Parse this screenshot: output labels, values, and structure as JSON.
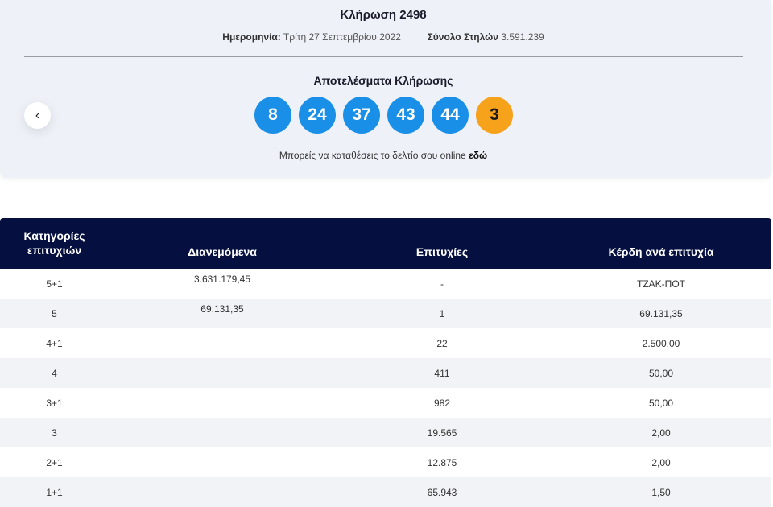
{
  "draw": {
    "title": "Κλήρωση 2498",
    "date_label": "Ημερομηνία:",
    "date_value": "Τρίτη 27 Σεπτεμβρίου 2022",
    "columns_label": "Σύνολο Στηλών",
    "columns_value": "3.591.239"
  },
  "results": {
    "title": "Αποτελέσματα Κλήρωσης",
    "numbers": [
      "8",
      "24",
      "37",
      "43",
      "44"
    ],
    "joker": "3",
    "online_text": "Μπορείς να καταθέσεις το δελτίο σου online",
    "online_link": "εδώ"
  },
  "nav": {
    "prev_icon": "‹"
  },
  "colors": {
    "ball": "#1a8fe8",
    "joker": "#f7a21b",
    "header": "#051040"
  },
  "table": {
    "headers": [
      "Κατηγορίες επιτυχιών",
      "Διανεμόμενα",
      "Επιτυχίες",
      "Κέρδη ανά επιτυχία"
    ],
    "rows": [
      [
        "5+1",
        "3.631.179,45",
        "-",
        "ΤΖΑΚ-ΠΟΤ"
      ],
      [
        "5",
        "69.131,35",
        "1",
        "69.131,35"
      ],
      [
        "4+1",
        "",
        "22",
        "2.500,00"
      ],
      [
        "4",
        "",
        "411",
        "50,00"
      ],
      [
        "3+1",
        "",
        "982",
        "50,00"
      ],
      [
        "3",
        "",
        "19.565",
        "2,00"
      ],
      [
        "2+1",
        "",
        "12.875",
        "2,00"
      ],
      [
        "1+1",
        "",
        "65.943",
        "1,50"
      ]
    ]
  }
}
